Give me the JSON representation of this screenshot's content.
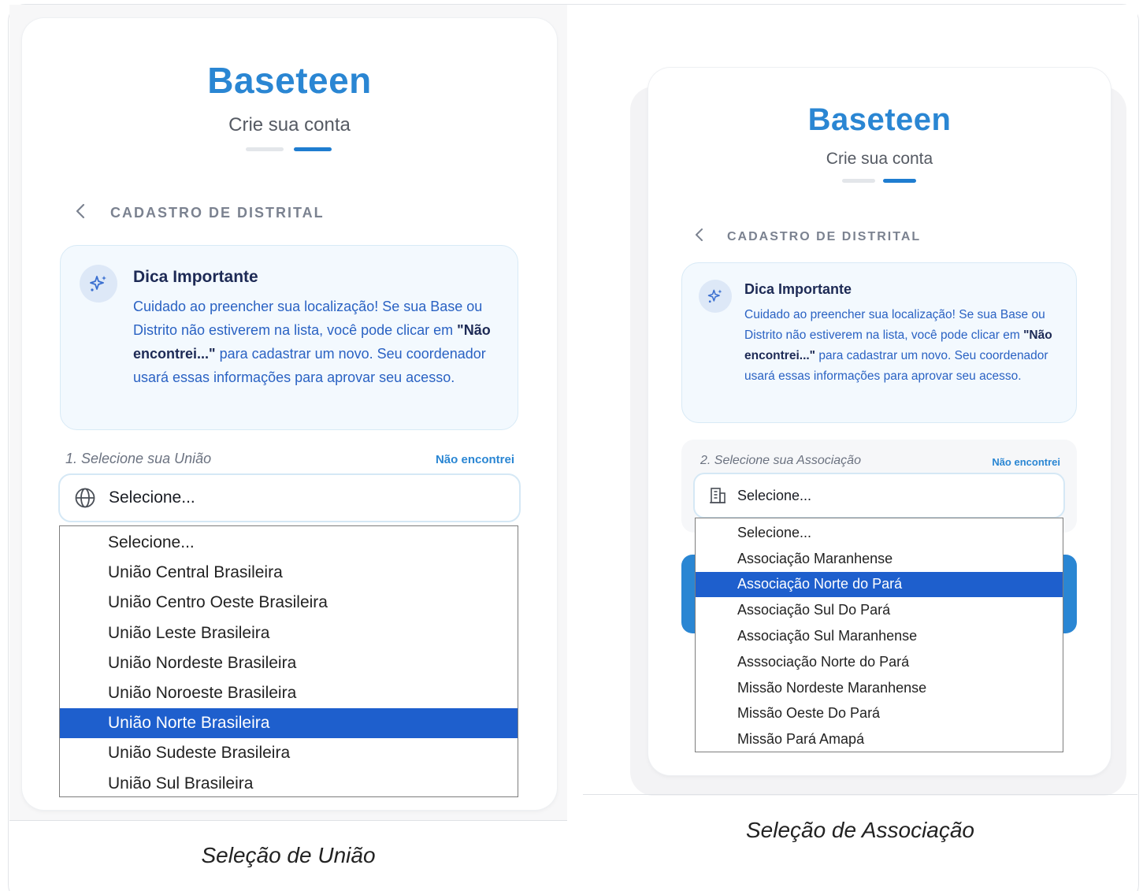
{
  "left_screen": {
    "brand": "Baseteen",
    "subtitle": "Crie sua conta",
    "section_label": "CADASTRO DE DISTRITAL",
    "tip": {
      "title": "Dica Importante",
      "body_before": "Cuidado ao preencher sua localização! Se sua Base ou Distrito não estiverem na lista, você pode clicar em ",
      "body_bold": "\"Não encontrei...\"",
      "body_after": " para cadastrar um novo. Seu coordenador usará essas informações para aprovar seu acesso."
    },
    "field_label": "1. Selecione sua União",
    "not_found_link": "Não encontrei",
    "select_value": "Selecione...",
    "options": [
      "Selecione...",
      "União Central Brasileira",
      "União Centro Oeste Brasileira",
      "União Leste Brasileira",
      "União Nordeste Brasileira",
      "União Noroeste Brasileira",
      "União Norte Brasileira",
      "União Sudeste Brasileira",
      "União Sul Brasileira"
    ],
    "selected_index": 6,
    "caption": "Seleção de União"
  },
  "right_screen": {
    "brand": "Baseteen",
    "subtitle": "Crie sua conta",
    "section_label": "CADASTRO DE DISTRITAL",
    "tip": {
      "title": "Dica Importante",
      "body_before": "Cuidado ao preencher sua localização! Se sua Base ou Distrito não estiverem na lista, você pode clicar em ",
      "body_bold": "\"Não encontrei...\"",
      "body_after": " para cadastrar um novo. Seu coordenador usará essas informações para aprovar seu acesso."
    },
    "field_label": "2. Selecione sua Associação",
    "not_found_link": "Não encontrei",
    "select_value": "Selecione...",
    "options": [
      "Selecione...",
      "Associação Maranhense",
      "Associação Norte do Pará",
      "Associação Sul Do Pará",
      "Associação Sul Maranhense",
      "Asssociação Norte do Pará",
      "Missão Nordeste Maranhense",
      "Missão Oeste Do Pará",
      "Missão Pará Amapá"
    ],
    "selected_index": 2,
    "caption": "Seleção de Associação"
  },
  "colors": {
    "brand_blue": "#2a86d3",
    "selected_option": "#1e5fcd",
    "tip_text": "#2a62c3",
    "tip_title": "#1d2a55"
  },
  "icons": {
    "back": "chevron-left-icon",
    "tip": "sparkles-icon",
    "uniao_select": "globe-icon",
    "associacao_select": "building-icon"
  }
}
